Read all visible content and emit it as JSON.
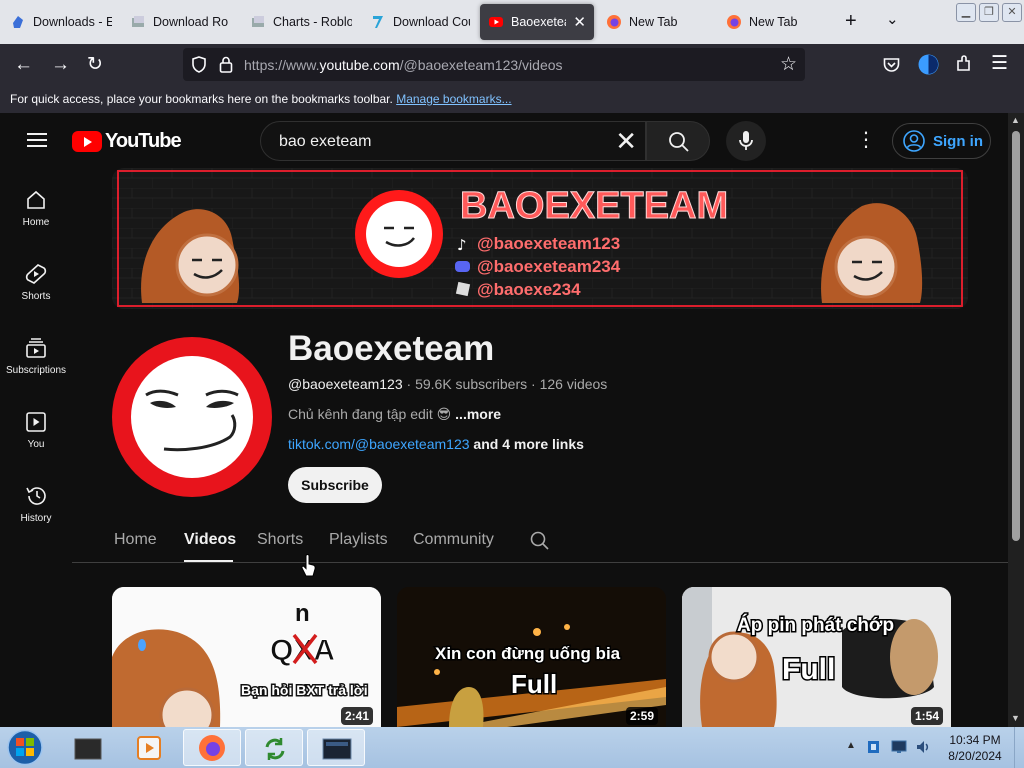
{
  "browser": {
    "tabs": [
      {
        "title": "Downloads - E",
        "icon": "downloads-favicon"
      },
      {
        "title": "Download Ro",
        "icon": "download-favicon"
      },
      {
        "title": "Charts - Roblo",
        "icon": "roblox-favicon"
      },
      {
        "title": "Download Cou",
        "icon": "download-favicon"
      },
      {
        "title": "Baoexeteam",
        "icon": "youtube-favicon",
        "active": true
      },
      {
        "title": "New Tab",
        "icon": "firefox-favicon"
      },
      {
        "title": "New Tab",
        "icon": "firefox-favicon"
      }
    ],
    "url_prefix": "https://www.",
    "url_domain": "youtube.com",
    "url_path": "/@baoexeteam123/videos",
    "bookmarks_hint": "For quick access, place your bookmarks here on the bookmarks toolbar.",
    "bookmarks_link": "Manage bookmarks..."
  },
  "youtube": {
    "logo_text": "YouTube",
    "search_value": "bao exeteam",
    "sign_in_label": "Sign in",
    "guide": [
      {
        "label": "Home",
        "icon": "home-icon"
      },
      {
        "label": "Shorts",
        "icon": "shorts-icon"
      },
      {
        "label": "Subscriptions",
        "icon": "subscriptions-icon"
      },
      {
        "label": "You",
        "icon": "you-icon"
      },
      {
        "label": "History",
        "icon": "history-icon"
      }
    ],
    "banner": {
      "title": "BAOEXETEAM",
      "tiktok": "@baoexeteam123",
      "discord": "@baoexeteam234",
      "roblox": "@baoexe234"
    },
    "channel": {
      "name": "Baoexeteam",
      "handle": "@baoexeteam123",
      "subscribers": "59.6K subscribers",
      "videos": "126 videos",
      "description": "Chủ kênh đang tập edit",
      "more": "...more",
      "link": "tiktok.com/@baoexeteam123",
      "more_links": "and 4 more links",
      "subscribe_label": "Subscribe"
    },
    "tabs": [
      "Home",
      "Videos",
      "Shorts",
      "Playlists",
      "Community"
    ],
    "active_tab": "Videos",
    "videos": [
      {
        "caption_top": "n",
        "caption_mid": "QXA",
        "caption": "Bạn hỏi BXT trả lời",
        "duration": "2:41"
      },
      {
        "caption": "Xin con đừng uống bia",
        "caption2": "Full",
        "duration": "2:59"
      },
      {
        "caption": "Áp pin phát chớp",
        "caption2": "Full",
        "duration": "1:54"
      }
    ]
  },
  "taskbar": {
    "time": "10:34 PM",
    "date": "8/20/2024"
  },
  "colors": {
    "youtube_red": "#ff0000",
    "link_blue": "#3ea6ff",
    "firefox_toolbar": "#2b2a33",
    "banner_neon": "#ff2030"
  }
}
